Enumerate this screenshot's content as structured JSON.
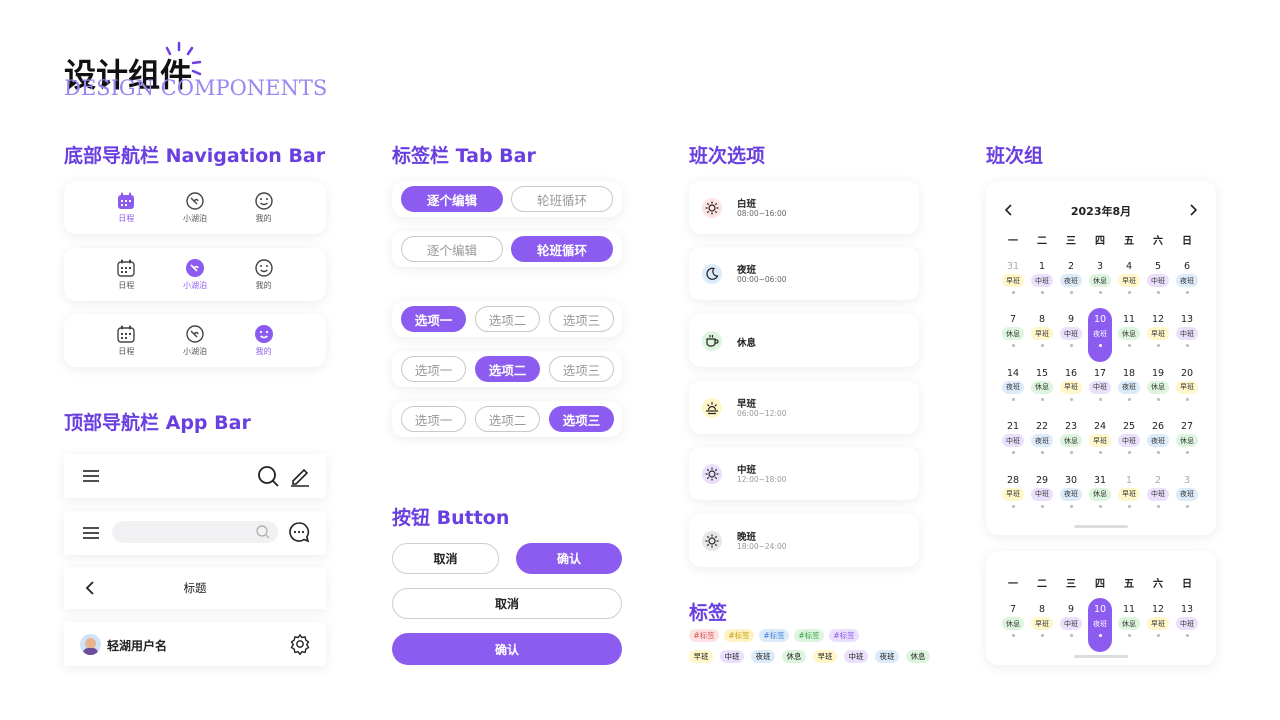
{
  "header": {
    "title": "设计组件",
    "subtitle": "DESIGN COMPONENTS"
  },
  "sections": {
    "nav_bar": "底部导航栏 Navigation Bar",
    "app_bar": "顶部导航栏 App Bar",
    "tab_bar": "标签栏 Tab Bar",
    "button": "按钮 Button",
    "shift_options": "班次选项",
    "tags": "标签",
    "shift_group": "班次组"
  },
  "nav": {
    "schedule": "日程",
    "lake": "小湖泊",
    "me": "我的"
  },
  "appbar": {
    "title": "标题",
    "username": "轻湖用户名"
  },
  "tabs": {
    "edit_each": "逐个编辑",
    "rotation": "轮班循环",
    "opt1": "选项一",
    "opt2": "选项二",
    "opt3": "选项三"
  },
  "buttons": {
    "cancel": "取消",
    "confirm": "确认"
  },
  "shifts": [
    {
      "name": "白班",
      "time": "08:00~16:00"
    },
    {
      "name": "夜班",
      "time": "00:00~06:00"
    },
    {
      "name": "休息",
      "time": ""
    },
    {
      "name": "早班",
      "time": "06:00~12:00"
    },
    {
      "name": "中班",
      "time": "12:00~18:00"
    },
    {
      "name": "晚班",
      "time": "18:00~24:00"
    }
  ],
  "tag_row1": [
    "#标签",
    "#标签",
    "#标签",
    "#标签",
    "#标签"
  ],
  "tag_row2": [
    "早班",
    "中班",
    "夜班",
    "休息",
    "早班",
    "中班",
    "夜班",
    "休息"
  ],
  "calendar": {
    "month": "2023年8月",
    "weekdays": [
      "一",
      "二",
      "三",
      "四",
      "五",
      "六",
      "日"
    ],
    "weeks": [
      {
        "days": [
          "31",
          "1",
          "2",
          "3",
          "4",
          "5",
          "6"
        ],
        "shifts": [
          "早班",
          "中班",
          "夜班",
          "休息",
          "早班",
          "中班",
          "夜班"
        ]
      },
      {
        "days": [
          "7",
          "8",
          "9",
          "10",
          "11",
          "12",
          "13"
        ],
        "shifts": [
          "休息",
          "早班",
          "中班",
          "夜班",
          "休息",
          "早班",
          "中班"
        ]
      },
      {
        "days": [
          "14",
          "15",
          "16",
          "17",
          "18",
          "19",
          "20"
        ],
        "shifts": [
          "夜班",
          "休息",
          "早班",
          "中班",
          "夜班",
          "休息",
          "早班"
        ]
      },
      {
        "days": [
          "21",
          "22",
          "23",
          "24",
          "25",
          "26",
          "27"
        ],
        "shifts": [
          "中班",
          "夜班",
          "休息",
          "早班",
          "中班",
          "夜班",
          "休息"
        ]
      },
      {
        "days": [
          "28",
          "29",
          "30",
          "31",
          "1",
          "2",
          "3"
        ],
        "shifts": [
          "早班",
          "中班",
          "夜班",
          "休息",
          "早班",
          "中班",
          "夜班"
        ]
      }
    ],
    "week_short": {
      "days": [
        "7",
        "8",
        "9",
        "10",
        "11",
        "12",
        "13"
      ],
      "shifts": [
        "休息",
        "早班",
        "中班",
        "夜班",
        "休息",
        "早班",
        "中班"
      ]
    }
  },
  "colors": {
    "accent": "#8B5CEF",
    "早班": "#FFF6C9",
    "中班": "#EBE0FC",
    "夜班": "#DCEBFA",
    "休息": "#DDF5DE"
  }
}
